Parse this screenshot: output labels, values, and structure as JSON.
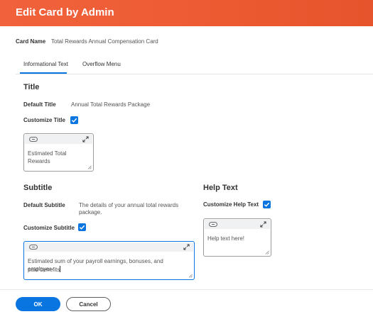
{
  "header": {
    "title": "Edit Card by Admin"
  },
  "card": {
    "name_label": "Card Name",
    "name_value": "Total Rewards Annual Compensation Card"
  },
  "tabs": [
    {
      "label": "Informational Text",
      "active": true
    },
    {
      "label": "Overflow Menu",
      "active": false
    }
  ],
  "title_section": {
    "heading": "Title",
    "default_label": "Default Title",
    "default_value": "Annual Total Rewards Package",
    "customize_label": "Customize Title",
    "customize_checked": true,
    "editor_text": "Estimated Total Rewards"
  },
  "subtitle_section": {
    "heading": "Subtitle",
    "default_label": "Default Subtitle",
    "default_value_line1": "The details of your annual total rewards",
    "default_value_line2": "package.",
    "customize_label": "Customize Subtitle",
    "customize_checked": true,
    "editor_text_line1": "Estimated sum of your payroll earnings, bonuses, and employer-",
    "editor_text_line2": "paid benefits"
  },
  "help_section": {
    "heading": "Help Text",
    "customize_label": "Customize Help Text",
    "customize_checked": true,
    "editor_text": "Help text here!"
  },
  "footer": {
    "ok_label": "OK",
    "cancel_label": "Cancel"
  },
  "colors": {
    "header": "#ec5a32",
    "accent": "#0875e1"
  },
  "icons": [
    "checkmark-icon",
    "text-pill-icon",
    "expand-icon",
    "resize-grip-icon"
  ]
}
